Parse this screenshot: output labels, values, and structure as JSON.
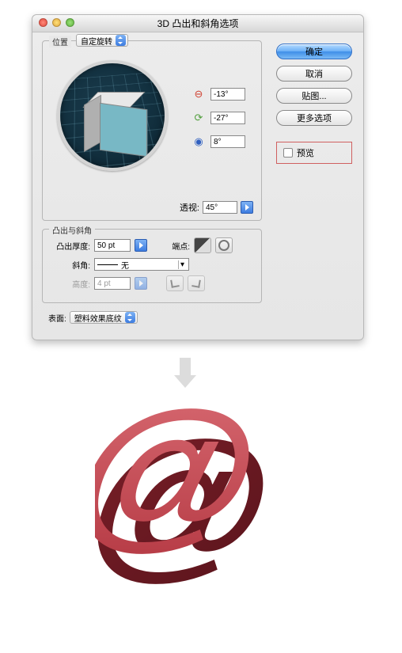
{
  "dialog": {
    "title": "3D 凸出和斜角选项",
    "position_group": {
      "legend": "位置",
      "mode": "自定旋转",
      "angle_x": "-13°",
      "angle_y": "-27°",
      "angle_z": "8°",
      "perspective_label": "透视:",
      "perspective_value": "45°"
    },
    "extrude_group": {
      "legend": "凸出与斜角",
      "depth_label": "凸出厚度:",
      "depth_value": "50 pt",
      "cap_label": "端点:",
      "bevel_label": "斜角:",
      "bevel_value": "无",
      "height_label": "高度:",
      "height_value": "4 pt"
    },
    "surface": {
      "label": "表面:",
      "value": "塑料效果底纹"
    },
    "buttons": {
      "ok": "确定",
      "cancel": "取消",
      "map_art": "贴图...",
      "more_options": "更多选项"
    },
    "preview_label": "预览"
  }
}
